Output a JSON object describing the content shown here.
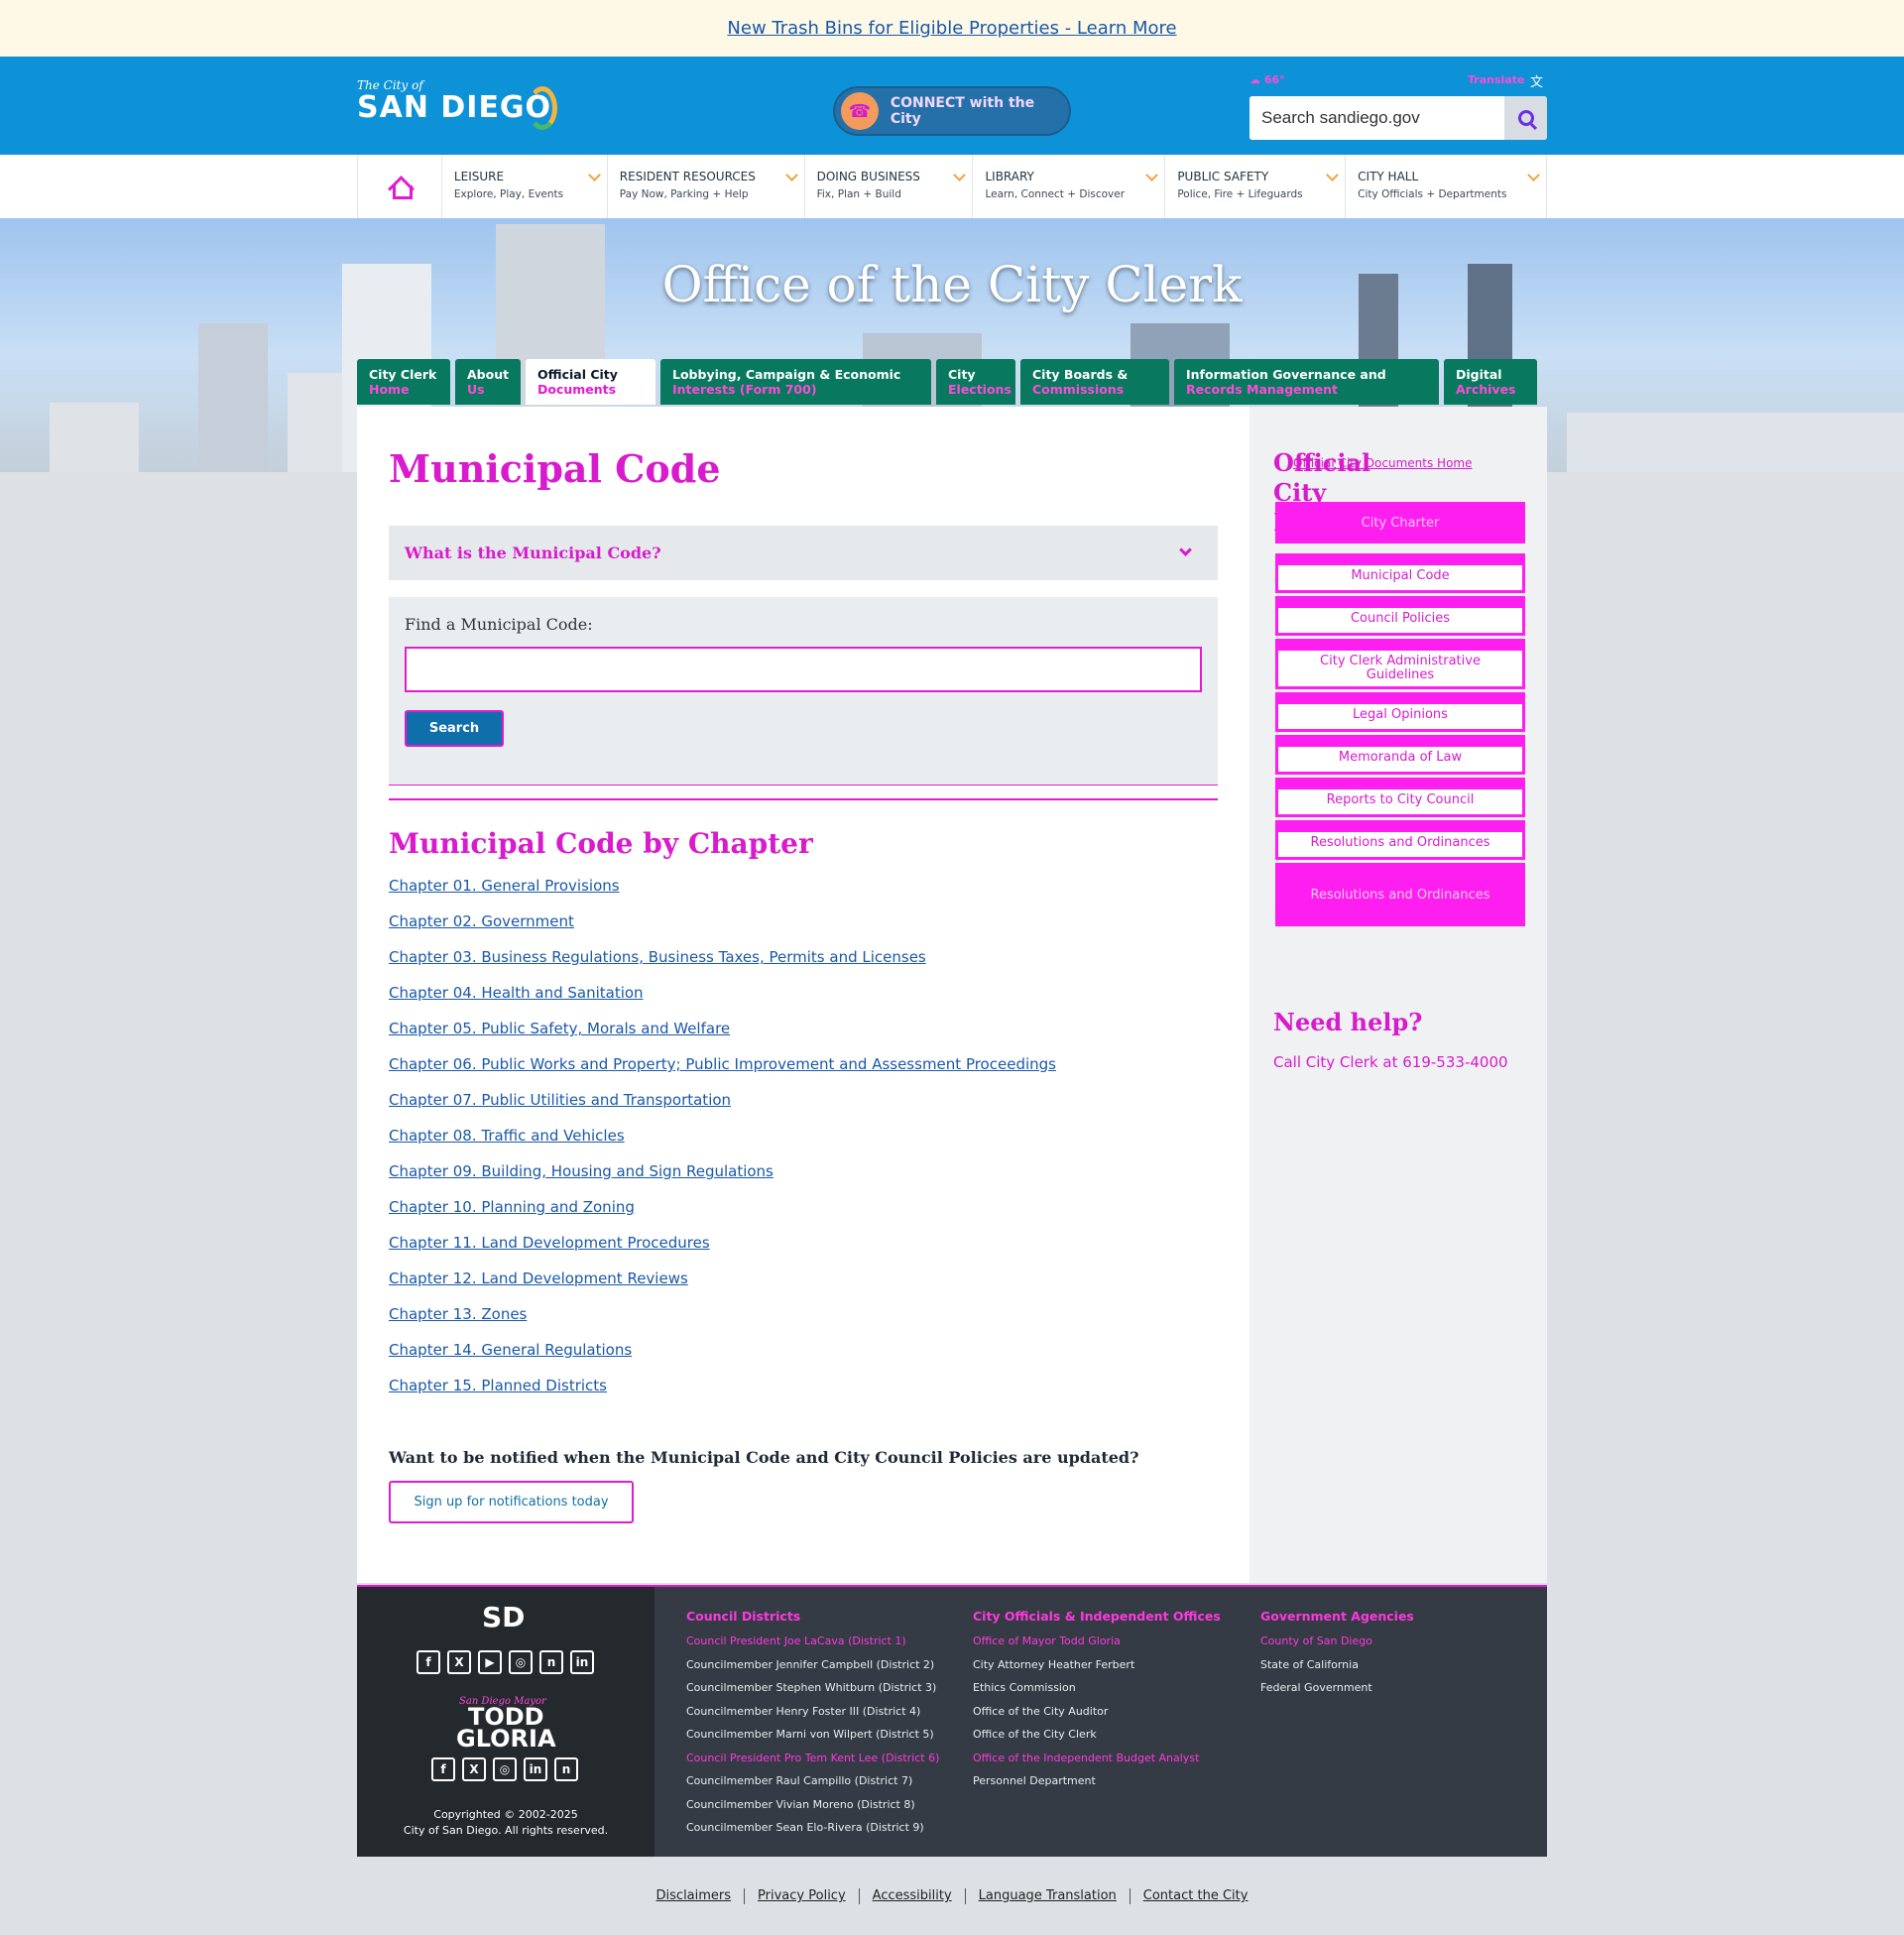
{
  "alert": {
    "text": "New Trash Bins for Eligible Properties - Learn More"
  },
  "header": {
    "logo_small": "The City of",
    "logo_big": "SAN DIEGO",
    "connect_label": "CONNECT with the City",
    "weather": "☁ 66°",
    "translate": "Translate",
    "search_placeholder": "Search sandiego.gov"
  },
  "nav": {
    "items": [
      {
        "title": "LEISURE",
        "sub": "Explore, Play, Events"
      },
      {
        "title": "RESIDENT RESOURCES",
        "sub": "Pay Now, Parking + Help"
      },
      {
        "title": "DOING BUSINESS",
        "sub": "Fix, Plan + Build"
      },
      {
        "title": "LIBRARY",
        "sub": "Learn, Connect + Discover"
      },
      {
        "title": "PUBLIC SAFETY",
        "sub": "Police, Fire + Lifeguards"
      },
      {
        "title": "CITY HALL",
        "sub": "City Officials + Departments"
      }
    ]
  },
  "hero": {
    "title": "Office of the City Clerk"
  },
  "tabs": [
    {
      "l1": "City Clerk",
      "l2": "Home"
    },
    {
      "l1": "About",
      "l2": "Us"
    },
    {
      "l1": "Official City",
      "l2": "Documents"
    },
    {
      "l1": "Lobbying, Campaign & Economic",
      "l2": "Interests (Form 700)"
    },
    {
      "l1": "City",
      "l2": "Elections"
    },
    {
      "l1": "City Boards &",
      "l2": "Commissions"
    },
    {
      "l1": "Information Governance and",
      "l2": "Records Management"
    },
    {
      "l1": "Digital",
      "l2": "Archives"
    }
  ],
  "main": {
    "title": "Municipal Code",
    "accordion_label": "What is the Municipal Code?",
    "find_label": "Find a Municipal Code:",
    "search_button": "Search",
    "chapters_title": "Municipal Code by Chapter",
    "chapters": [
      "Chapter 01. General Provisions",
      "Chapter 02. Government",
      "Chapter 03. Business Regulations, Business Taxes, Permits and Licenses",
      "Chapter 04. Health and Sanitation",
      "Chapter 05. Public Safety, Morals and Welfare",
      "Chapter 06. Public Works and Property; Public Improvement and Assessment Proceedings",
      "Chapter 07. Public Utilities and Transportation",
      "Chapter 08. Traffic and Vehicles",
      "Chapter 09. Building, Housing and Sign Regulations",
      "Chapter 10. Planning and Zoning",
      "Chapter 11. Land Development Procedures",
      "Chapter 12. Land Development Reviews",
      "Chapter 13. Zones",
      "Chapter 14. General Regulations",
      "Chapter 15. Planned Districts"
    ],
    "notify_text": "Want to be notified when the Municipal Code and City Council Policies are updated?",
    "notify_button": "Sign up for notifications today"
  },
  "sidebar": {
    "title": "Official City Documents",
    "home_link": "Official City Documents Home",
    "menu_head": "City Charter",
    "links": [
      "Municipal Code",
      "Council Policies",
      "City Clerk Administrative Guidelines",
      "Legal Opinions",
      "Memoranda of Law",
      "Reports to City Council",
      "Resolutions and Ordinances"
    ],
    "menu_foot": "Resolutions and Ordinances",
    "help_title": "Need help?",
    "help_call": "Call City Clerk at 619-533-4000"
  },
  "footer": {
    "sd_mark": "SD",
    "social_city": [
      "f",
      "X",
      "▶",
      "◎",
      "n",
      "in"
    ],
    "mayor_small": "San Diego Mayor",
    "mayor_big_1": "TODD",
    "mayor_big_2": "GLORIA",
    "social_mayor": [
      "f",
      "X",
      "◎",
      "in",
      "n"
    ],
    "copyright_1": "Copyrighted © 2002-2025",
    "copyright_2": "City of San Diego. All rights reserved.",
    "col1_title": "Council Districts",
    "col1": [
      {
        "text": "Council President Joe LaCava (District 1)",
        "hl": true
      },
      {
        "text": "Councilmember Jennifer Campbell (District 2)",
        "hl": false
      },
      {
        "text": "Councilmember Stephen Whitburn (District 3)",
        "hl": false
      },
      {
        "text": "Councilmember Henry Foster III (District 4)",
        "hl": false
      },
      {
        "text": "Councilmember Marni von Wilpert (District 5)",
        "hl": false
      },
      {
        "text": "Council President Pro Tem Kent Lee (District 6)",
        "hl": true
      },
      {
        "text": "Councilmember Raul Campillo (District 7)",
        "hl": false
      },
      {
        "text": "Councilmember Vivian Moreno (District 8)",
        "hl": false
      },
      {
        "text": "Councilmember Sean Elo-Rivera (District 9)",
        "hl": false
      }
    ],
    "col2_title": "City Officials & Independent Offices",
    "col2": [
      {
        "text": "Office of Mayor Todd Gloria",
        "hl": true
      },
      {
        "text": "City Attorney Heather Ferbert",
        "hl": false
      },
      {
        "text": "Ethics Commission",
        "hl": false
      },
      {
        "text": "Office of the City Auditor",
        "hl": false
      },
      {
        "text": "Office of the City Clerk",
        "hl": false
      },
      {
        "text": "Office of the Independent Budget Analyst",
        "hl": true
      },
      {
        "text": "Personnel Department",
        "hl": false
      }
    ],
    "col3_title": "Government Agencies",
    "col3": [
      {
        "text": "County of San Diego",
        "hl": true
      },
      {
        "text": "State of California",
        "hl": false
      },
      {
        "text": "Federal Government",
        "hl": false
      }
    ]
  },
  "bottom_links": [
    "Disclaimers",
    "Privacy Policy",
    "Accessibility",
    "Language Translation",
    "Contact the City"
  ]
}
